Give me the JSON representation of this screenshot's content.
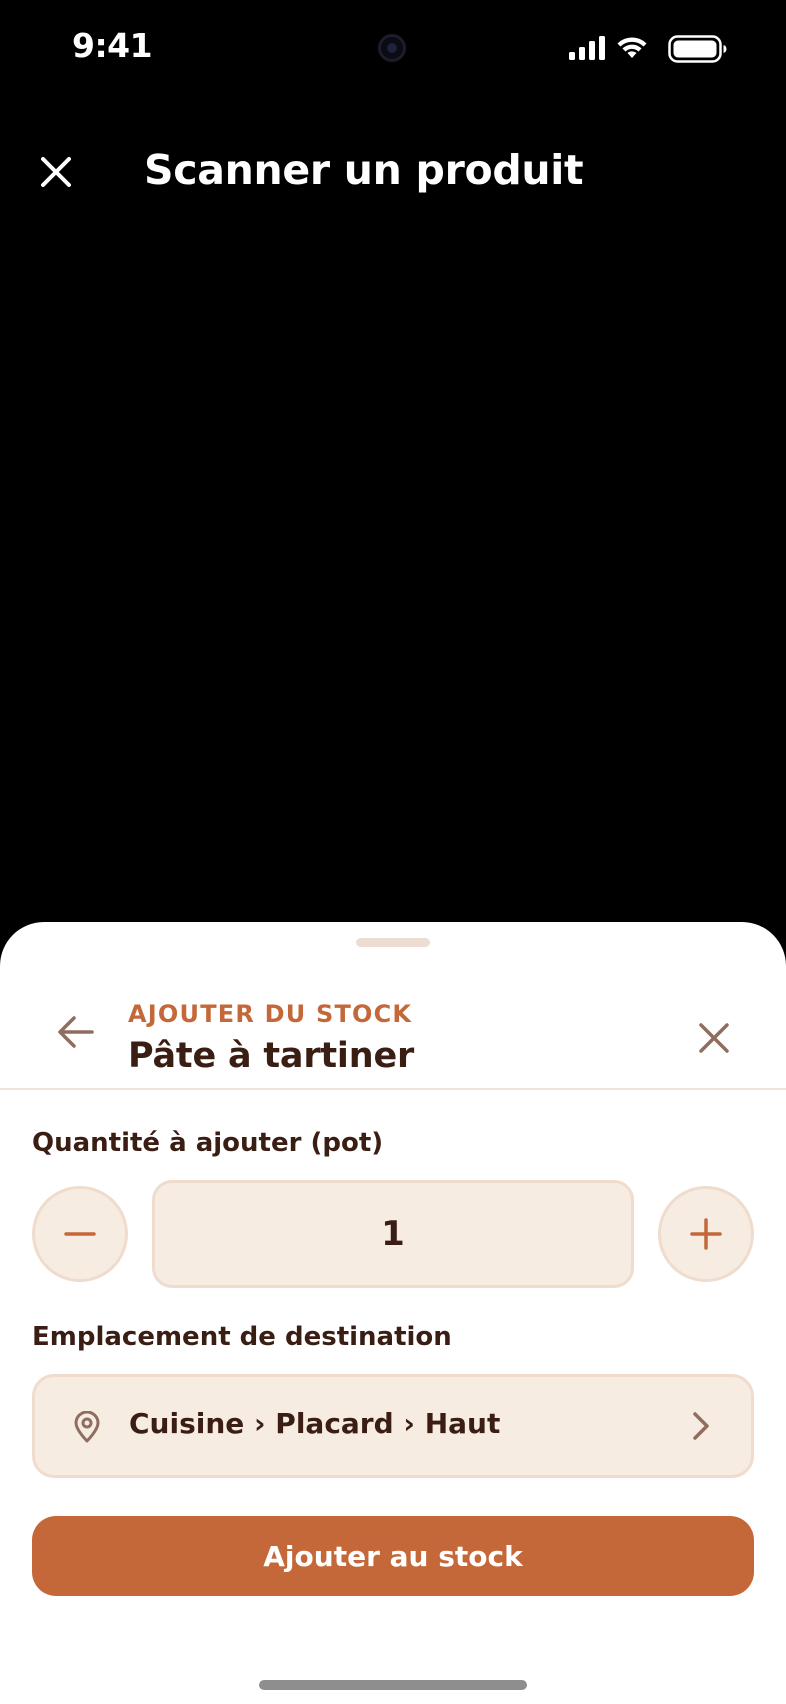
{
  "status_bar": {
    "time": "9:41"
  },
  "header": {
    "title": "Scanner un produit",
    "close_icon": "close-icon"
  },
  "sheet": {
    "eyebrow": "AJOUTER DU STOCK",
    "product_name": "Pâte à tartiner",
    "back_icon": "arrow-left-icon",
    "close_icon": "close-icon"
  },
  "quantity": {
    "label": "Quantité à ajouter (pot)",
    "value": "1",
    "decrement_icon": "minus-icon",
    "increment_icon": "plus-icon"
  },
  "destination": {
    "label": "Emplacement de destination",
    "value": "Cuisine › Placard › Haut",
    "icon": "map-pin-icon",
    "chevron_icon": "chevron-right-icon"
  },
  "submit": {
    "label": "Ajouter au stock"
  },
  "colors": {
    "accent": "#c4683a",
    "text_dark": "#3a1e14",
    "field_bg": "#f7ece2",
    "field_border": "#efdccd",
    "camera_bg": "#000000"
  }
}
